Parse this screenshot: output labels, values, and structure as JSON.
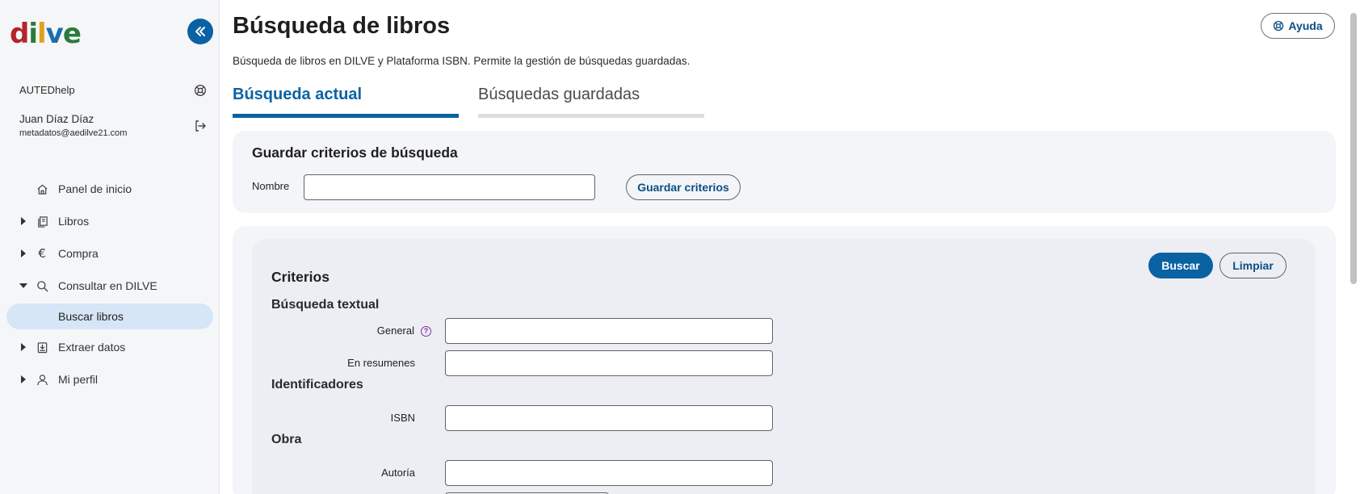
{
  "brand": {
    "logo_letters": [
      "d",
      "i",
      "l",
      "v",
      "e"
    ],
    "logo_colors": [
      "#b3242b",
      "#2a7a3a",
      "#e0a21b",
      "#1a6fb0",
      "#2a7a3a"
    ],
    "accent": "#0a62a3"
  },
  "sidebar": {
    "org": "AUTEDhelp",
    "user_name": "Juan Díaz Díaz",
    "user_email": "metadatos@aedilve21.com",
    "items": [
      {
        "label": "Panel de inicio",
        "icon": "home-icon",
        "expandable": false
      },
      {
        "label": "Libros",
        "icon": "books-icon",
        "expandable": true
      },
      {
        "label": "Compra",
        "icon": "euro-icon",
        "expandable": true
      },
      {
        "label": "Consultar en DILVE",
        "icon": "search-icon",
        "expandable": true,
        "expanded": true
      },
      {
        "label": "Extraer datos",
        "icon": "download-icon",
        "expandable": true
      },
      {
        "label": "Mi perfil",
        "icon": "user-icon",
        "expandable": true
      }
    ],
    "sub_item": "Buscar libros"
  },
  "header": {
    "title": "Búsqueda de libros",
    "help_label": "Ayuda",
    "subtitle": "Búsqueda de libros en DILVE y Plataforma ISBN. Permite la gestión de búsquedas guardadas."
  },
  "tabs": [
    {
      "label": "Búsqueda actual",
      "active": true
    },
    {
      "label": "Búsquedas guardadas",
      "active": false
    }
  ],
  "save_panel": {
    "title": "Guardar criterios de búsqueda",
    "name_label": "Nombre",
    "name_value": "",
    "save_button": "Guardar criterios"
  },
  "criteria": {
    "title": "Criterios",
    "search_button": "Buscar",
    "clear_button": "Limpiar",
    "sections": {
      "textual": "Búsqueda textual",
      "identifiers": "Identificadores",
      "work": "Obra"
    },
    "fields": {
      "general": "General",
      "summaries": "En resumenes",
      "isbn": "ISBN",
      "author": "Autoría"
    }
  }
}
